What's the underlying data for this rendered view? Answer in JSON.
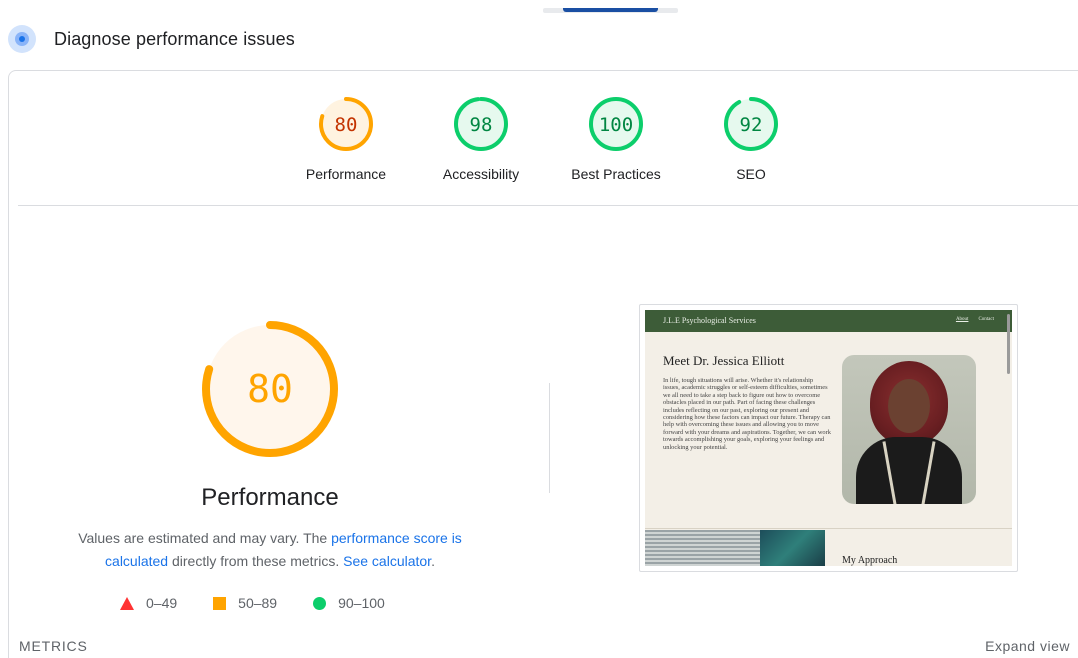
{
  "header": {
    "title": "Diagnose performance issues",
    "icon": "lighthouse-icon"
  },
  "gauges": [
    {
      "score": "80",
      "label": "Performance",
      "fraction": 0.8,
      "color": "#ffa400",
      "text_color": "#c33300",
      "bg": "#fff3e0"
    },
    {
      "score": "98",
      "label": "Accessibility",
      "fraction": 0.98,
      "color": "#0cce6b",
      "text_color": "#018642",
      "bg": "#e6f9ee"
    },
    {
      "score": "100",
      "label": "Best Practices",
      "fraction": 1.0,
      "color": "#0cce6b",
      "text_color": "#018642",
      "bg": "#e6f9ee"
    },
    {
      "score": "92",
      "label": "SEO",
      "fraction": 0.92,
      "color": "#0cce6b",
      "text_color": "#018642",
      "bg": "#e6f9ee"
    }
  ],
  "performance": {
    "score": "80",
    "fraction": 0.8,
    "title": "Performance",
    "desc_prefix": "Values are estimated and may vary. The ",
    "desc_link1": "performance score is calculated",
    "desc_middle": " directly from these metrics. ",
    "desc_link2": "See calculator",
    "desc_suffix": "."
  },
  "legend": [
    {
      "range": "0–49",
      "shape": "triangle",
      "color": "#ff3333"
    },
    {
      "range": "50–89",
      "shape": "square",
      "color": "#ffa400"
    },
    {
      "range": "90–100",
      "shape": "circle",
      "color": "#0cce6b"
    }
  ],
  "screenshot": {
    "brand": "J.L.E Psychological Services",
    "nav_links": [
      "About",
      "Contact"
    ],
    "heading": "Meet Dr. Jessica Elliott",
    "body": "In life, tough situations will arise. Whether it's relationship issues, academic struggles or self-esteem difficulties, sometimes we all need to take a step back to figure out how to overcome obstacles placed in our path. Part of facing these challenges includes reflecting on our past, exploring our present and considering how these factors can impact our future. Therapy can help with overcoming these issues and allowing you to move forward with your dreams and aspirations. Together, we can work towards accomplishing your goals, exploring your feelings and unlocking your potential.",
    "subheading": "My Approach"
  },
  "footer": {
    "metrics_label": "METRICS",
    "expand_label": "Expand view"
  }
}
